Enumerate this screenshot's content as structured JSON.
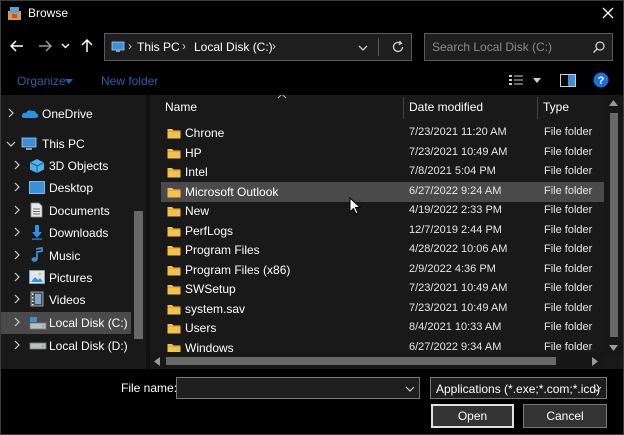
{
  "window": {
    "title": "Browse"
  },
  "nav": {
    "breadcrumb": [
      "This PC",
      "Local Disk (C:)"
    ],
    "search_placeholder": "Search Local Disk (C:)"
  },
  "toolbar": {
    "organize_label": "Organize",
    "new_folder_label": "New folder"
  },
  "sidebar": {
    "items": [
      {
        "label": "OneDrive",
        "icon": "onedrive-icon"
      },
      {
        "label": "This PC",
        "icon": "this-pc-icon"
      },
      {
        "label": "3D Objects",
        "icon": "3d-objects-icon"
      },
      {
        "label": "Desktop",
        "icon": "desktop-icon"
      },
      {
        "label": "Documents",
        "icon": "documents-icon"
      },
      {
        "label": "Downloads",
        "icon": "downloads-icon"
      },
      {
        "label": "Music",
        "icon": "music-icon"
      },
      {
        "label": "Pictures",
        "icon": "pictures-icon"
      },
      {
        "label": "Videos",
        "icon": "videos-icon"
      },
      {
        "label": "Local Disk (C:)",
        "icon": "drive-icon",
        "selected": true
      },
      {
        "label": "Local Disk (D:)",
        "icon": "drive-icon"
      }
    ]
  },
  "file_list": {
    "columns": [
      "Name",
      "Date modified",
      "Type"
    ],
    "rows": [
      {
        "name": "Chrone",
        "date": "7/23/2021 11:20 AM",
        "type": "File folder"
      },
      {
        "name": "HP",
        "date": "7/23/2021 10:49 AM",
        "type": "File folder"
      },
      {
        "name": "Intel",
        "date": "7/8/2021 5:04 PM",
        "type": "File folder"
      },
      {
        "name": "Microsoft Outlook",
        "date": "6/27/2022 9:24 AM",
        "type": "File folder",
        "hover": true
      },
      {
        "name": "New",
        "date": "4/19/2022 2:33 PM",
        "type": "File folder"
      },
      {
        "name": "PerfLogs",
        "date": "12/7/2019 2:44 PM",
        "type": "File folder"
      },
      {
        "name": "Program Files",
        "date": "4/28/2022 10:06 AM",
        "type": "File folder"
      },
      {
        "name": "Program Files (x86)",
        "date": "2/9/2022 4:36 PM",
        "type": "File folder"
      },
      {
        "name": "SWSetup",
        "date": "7/23/2021 10:49 AM",
        "type": "File folder"
      },
      {
        "name": "system.sav",
        "date": "7/23/2021 10:49 AM",
        "type": "File folder"
      },
      {
        "name": "Users",
        "date": "8/4/2021 10:33 AM",
        "type": "File folder"
      },
      {
        "name": "Windows",
        "date": "6/27/2022 9:34 AM",
        "type": "File folder"
      }
    ]
  },
  "bottom": {
    "file_name_label": "File name:",
    "file_name_value": "",
    "file_type_value": "Applications (*.exe;*.com;*.icd)",
    "open_label": "Open",
    "cancel_label": "Cancel"
  },
  "colors": {
    "background": "#191919",
    "selection": "#4a4a4a",
    "folder": "#f2c14e",
    "disabled_link": "#2a5fa8",
    "help": "#1e6fd9"
  }
}
